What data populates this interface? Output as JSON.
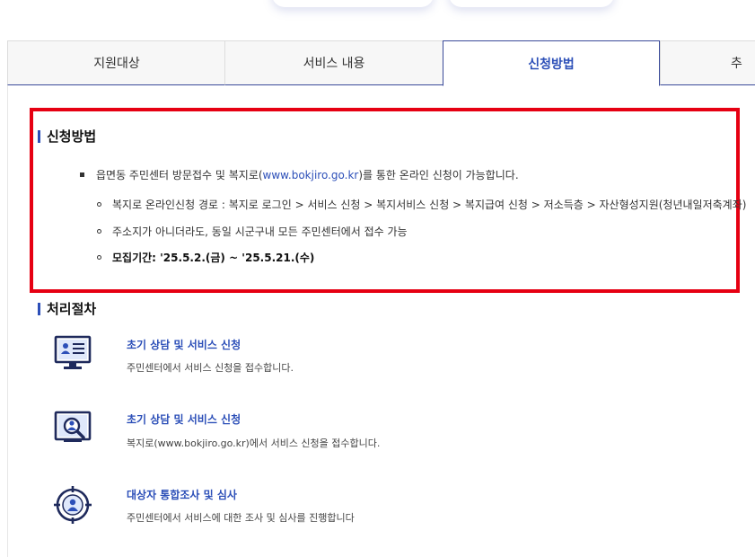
{
  "tabs": [
    {
      "label": "지원대상",
      "active": false
    },
    {
      "label": "서비스 내용",
      "active": false
    },
    {
      "label": "신청방법",
      "active": true
    },
    {
      "label": "추",
      "active": false
    }
  ],
  "apply": {
    "title": "신청방법",
    "main_bullet": {
      "prefix": "읍면동 주민센터 방문접수 및 복지로(",
      "link": "www.bokjiro.go.kr",
      "suffix": ")를 통한 온라인 신청이 가능합니다."
    },
    "sub_items": [
      "복지로 온라인신청 경로 : 복지로 로그인 > 서비스 신청 > 복지서비스 신청 > 복지급여 신청 > 저소득층 > 자산형성지원(청년내일저축계좌)",
      "주소지가 아니더라도, 동일 시군구내 모든 주민센터에서 접수 가능",
      "모집기간: '25.5.2.(금) ~ '25.5.21.(수)"
    ]
  },
  "process": {
    "title": "처리절차",
    "steps": [
      {
        "icon": "monitor-document-icon",
        "title": "초기 상담 및 서비스 신청",
        "desc": "주민센터에서 서비스 신청을 접수합니다."
      },
      {
        "icon": "monitor-search-icon",
        "title": "초기 상담 및 서비스 신청",
        "desc": "복지로(www.bokjiro.go.kr)에서 서비스 신청을 접수합니다."
      },
      {
        "icon": "target-person-icon",
        "title": "대상자 통합조사 및 심사",
        "desc": "주민센터에서 서비스에 대한 조사 및 심사를 진행합니다"
      }
    ]
  },
  "colors": {
    "accent": "#2c4fb8",
    "highlight_border": "#e60012",
    "icon_dark": "#1f2a5c"
  }
}
